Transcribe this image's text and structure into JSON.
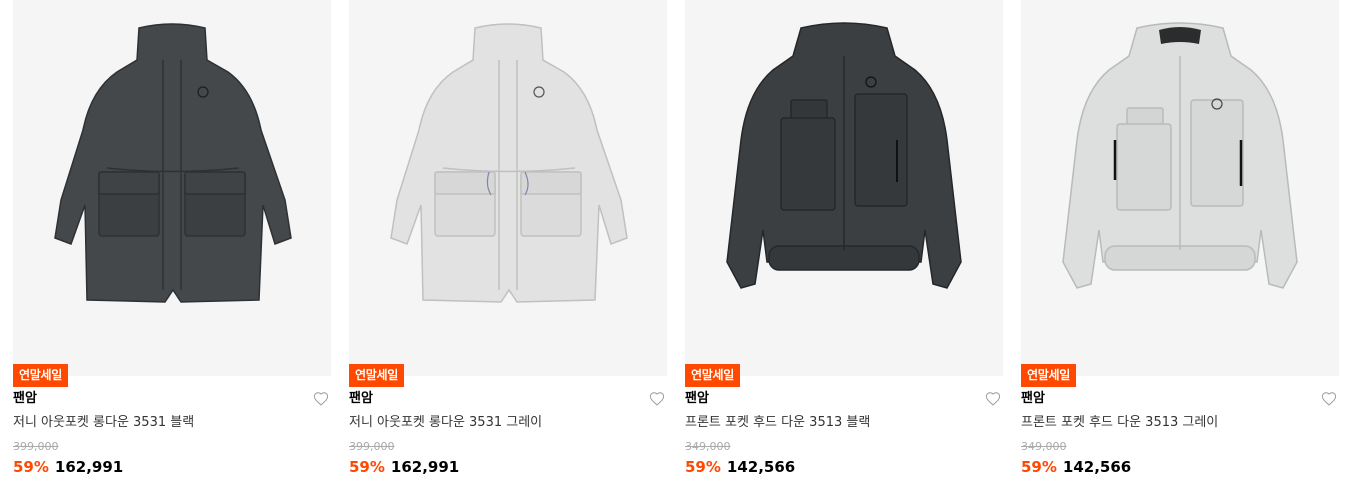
{
  "products": [
    {
      "badge": "연말세일",
      "brand": "팬암",
      "name": "저니 아웃포켓 롱다운 3531 블랙",
      "original_price": "399,000",
      "discount": "59%",
      "price": "162,991",
      "image_icon": "long-down-coat-black"
    },
    {
      "badge": "연말세일",
      "brand": "팬암",
      "name": "저니 아웃포켓 롱다운 3531 그레이",
      "original_price": "399,000",
      "discount": "59%",
      "price": "162,991",
      "image_icon": "long-down-coat-gray"
    },
    {
      "badge": "연말세일",
      "brand": "팬암",
      "name": "프론트 포켓 후드 다운 3513 블랙",
      "original_price": "349,000",
      "discount": "59%",
      "price": "142,566",
      "image_icon": "hooded-down-jacket-black"
    },
    {
      "badge": "연말세일",
      "brand": "팬암",
      "name": "프론트 포켓 후드 다운 3513 그레이",
      "original_price": "349,000",
      "discount": "59%",
      "price": "142,566",
      "image_icon": "hooded-down-jacket-gray"
    }
  ],
  "colors": {
    "accent": "#ff4800",
    "thumb_bg": "#f5f5f5",
    "jacket_black": "#3b3f42",
    "jacket_gray": "#dcdfdd",
    "coat_black": "#45484a",
    "coat_gray": "#e1e2e1"
  },
  "icons": {
    "wishlist": "heart-outline-icon"
  }
}
